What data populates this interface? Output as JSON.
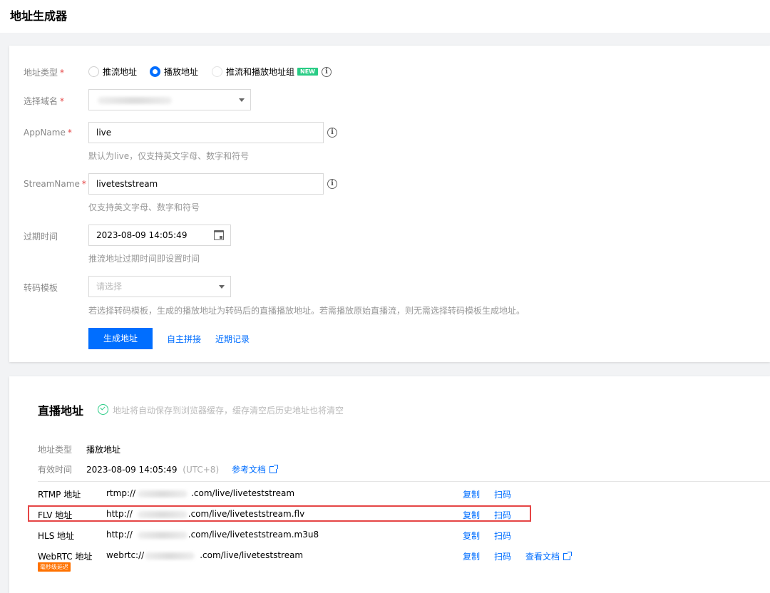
{
  "page": {
    "title": "地址生成器"
  },
  "form": {
    "address_type": {
      "label": "地址类型",
      "required_mark": "*",
      "options": [
        {
          "label": "推流地址",
          "selected": false
        },
        {
          "label": "播放地址",
          "selected": true
        },
        {
          "label": "推流和播放地址组",
          "selected": false,
          "disabled": true,
          "badge": "NEW"
        }
      ]
    },
    "domain": {
      "label": "选择域名",
      "required_mark": "*"
    },
    "app_name": {
      "label": "AppName",
      "required_mark": "*",
      "value": "live",
      "hint": "默认为live，仅支持英文字母、数字和符号"
    },
    "stream_name": {
      "label": "StreamName",
      "required_mark": "*",
      "value": "liveteststream",
      "hint": "仅支持英文字母、数字和符号"
    },
    "expire": {
      "label": "过期时间",
      "value": "2023-08-09 14:05:49",
      "hint": "推流地址过期时间即设置时间"
    },
    "template": {
      "label": "转码模板",
      "placeholder": "请选择",
      "hint": "若选择转码模板，生成的播放地址为转码后的直播播放地址。若需播放原始直播流，则无需选择转码模板生成地址。"
    },
    "actions": {
      "generate": "生成地址",
      "custom": "自主拼接",
      "recent": "近期记录"
    }
  },
  "result": {
    "title": "直播地址",
    "note": "地址将自动保存到浏览器缓存，缓存清空后历史地址也将清空",
    "type_key": "地址类型",
    "type_value": "播放地址",
    "valid_key": "有效时间",
    "valid_value": "2023-08-09 14:05:49",
    "valid_tz": "(UTC+8)",
    "doc_link": "参考文档",
    "rows": [
      {
        "label": "RTMP 地址",
        "prefix": "rtmp://",
        "suffix": ".com/live/liveteststream",
        "copy": "复制",
        "scan": "扫码"
      },
      {
        "label": "FLV 地址",
        "prefix": "http://",
        "suffix": ".com/live/liveteststream.flv",
        "copy": "复制",
        "scan": "扫码"
      },
      {
        "label": "HLS 地址",
        "prefix": "http://",
        "suffix": ".com/live/liveteststream.m3u8",
        "copy": "复制",
        "scan": "扫码"
      },
      {
        "label": "WebRTC 地址",
        "prefix": "webrtc://",
        "suffix": ".com/live/liveteststream",
        "copy": "复制",
        "scan": "扫码",
        "doc": "查看文档",
        "badge": "毫秒级延迟"
      }
    ]
  },
  "colors": {
    "primary": "#006eff",
    "success": "#29cc85",
    "danger": "#e54545",
    "warning": "#ff7200"
  }
}
